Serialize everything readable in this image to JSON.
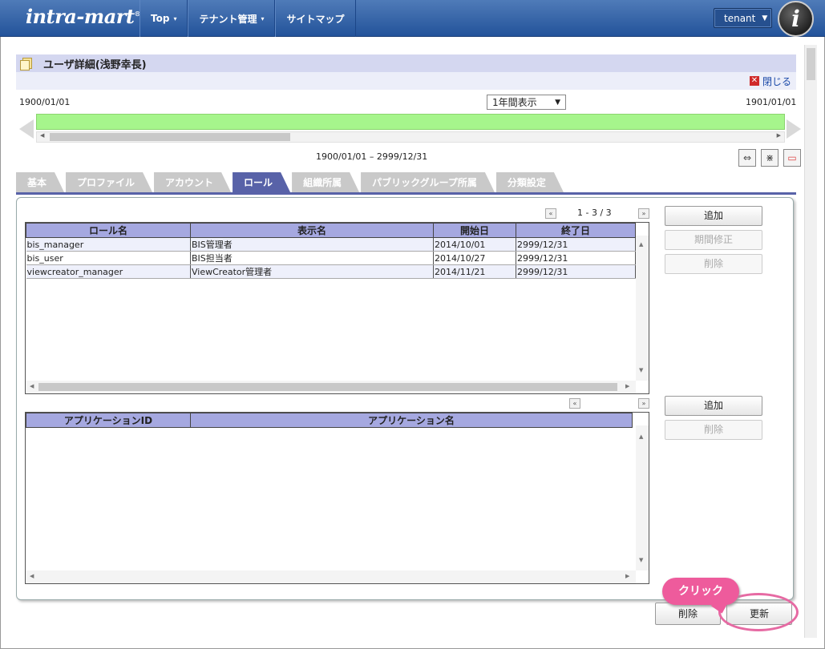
{
  "header": {
    "logo_text": "intra-mart",
    "logo_mark": "®",
    "nav": [
      {
        "label": "Top"
      },
      {
        "label": "テナント管理"
      },
      {
        "label": "サイトマップ"
      }
    ],
    "caret": "▾",
    "tenant_label": "tenant",
    "tenant_caret": "▼",
    "app_icon_letter": "i"
  },
  "title": {
    "text": "ユーザ詳細(浅野幸長)",
    "close_label": "閉じる",
    "close_icon_glyph": "✕"
  },
  "timeline": {
    "start_date": "1900/01/01",
    "end_date": "1901/01/01",
    "period_value": "1年間表示",
    "period_caret": "▼",
    "range_text": "1900/01/01 – 2999/12/31",
    "bar_color": "#a6f58c",
    "tools": [
      "⇔",
      "⋇",
      "▭"
    ]
  },
  "tabs": [
    {
      "label": "基本",
      "active": false
    },
    {
      "label": "プロファイル",
      "active": false
    },
    {
      "label": "アカウント",
      "active": false
    },
    {
      "label": "ロール",
      "active": true
    },
    {
      "label": "組織所属",
      "active": false
    },
    {
      "label": "パブリックグループ所属",
      "active": false
    },
    {
      "label": "分類設定",
      "active": false
    }
  ],
  "roles": {
    "pager_text": "1 - 3 / 3",
    "prev_glyph": "«",
    "next_glyph": "»",
    "columns": [
      "ロール名",
      "表示名",
      "開始日",
      "終了日"
    ],
    "rows": [
      [
        "bis_manager",
        "BIS管理者",
        "2014/10/01",
        "2999/12/31"
      ],
      [
        "bis_user",
        "BIS担当者",
        "2014/10/27",
        "2999/12/31"
      ],
      [
        "viewcreator_manager",
        "ViewCreator管理者",
        "2014/11/21",
        "2999/12/31"
      ]
    ],
    "buttons": {
      "add": "追加",
      "modify_period": "期間修正",
      "delete": "削除"
    }
  },
  "applications": {
    "prev_glyph": "«",
    "next_glyph": "»",
    "columns": [
      "アプリケーションID",
      "アプリケーション名"
    ],
    "rows": [],
    "buttons": {
      "add": "追加",
      "delete": "削除"
    }
  },
  "footer": {
    "delete_label": "削除",
    "update_label": "更新"
  },
  "annotation": {
    "callout_text": "クリック",
    "color": "#ee5b9c"
  },
  "scroll_arrows": {
    "up": "▲",
    "down": "▼",
    "left": "◀",
    "right": "▶"
  }
}
